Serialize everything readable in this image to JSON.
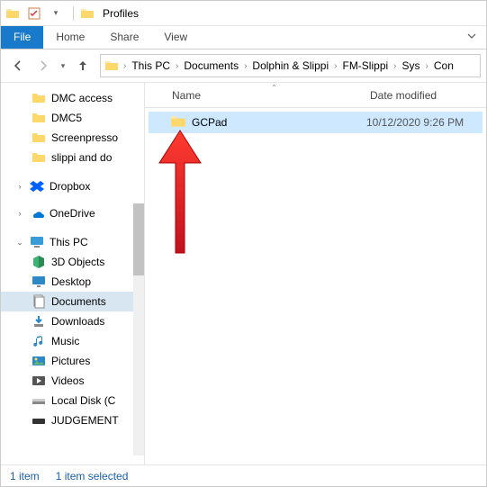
{
  "window": {
    "title": "Profiles"
  },
  "ribbon": {
    "file": "File",
    "tabs": [
      "Home",
      "Share",
      "View"
    ]
  },
  "breadcrumb": {
    "items": [
      "This PC",
      "Documents",
      "Dolphin & Slippi",
      "FM-Slippi",
      "Sys",
      "Con"
    ]
  },
  "columns": {
    "name": "Name",
    "date": "Date modified"
  },
  "quick_access": {
    "items": [
      "DMC access",
      "DMC5",
      "Screenpresso",
      "slippi and do"
    ]
  },
  "cloud": {
    "dropbox": "Dropbox",
    "onedrive": "OneDrive"
  },
  "thispc": {
    "label": "This PC",
    "children": [
      "3D Objects",
      "Desktop",
      "Documents",
      "Downloads",
      "Music",
      "Pictures",
      "Videos",
      "Local Disk (C",
      "JUDGEMENT"
    ]
  },
  "files": [
    {
      "name": "GCPad",
      "date": "10/12/2020 9:26 PM"
    }
  ],
  "status": {
    "count": "1 item",
    "selected": "1 item selected"
  }
}
